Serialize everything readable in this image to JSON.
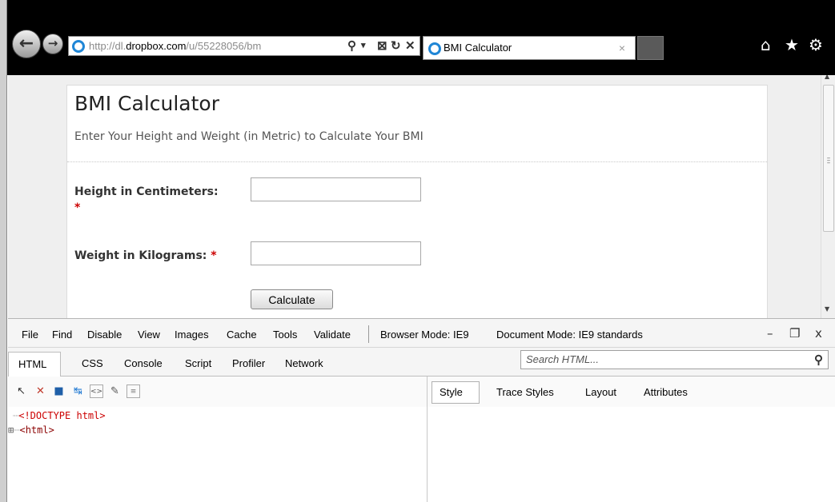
{
  "browser": {
    "address": {
      "prefix": "http://dl.",
      "domain": "dropbox.com",
      "path": "/u/55228056/bm"
    },
    "tab_title": "BMI Calculator",
    "tab_close": "×",
    "icons": [
      "back-icon",
      "forward-icon",
      "search-icon",
      "compat-view-icon",
      "refresh-icon",
      "stop-icon",
      "home-icon",
      "favorites-icon",
      "settings-icon"
    ]
  },
  "page": {
    "title": "BMI Calculator",
    "subtitle": "Enter Your Height and Weight (in Metric) to Calculate Your BMI",
    "height_label": "Height in Centimeters:",
    "weight_label": "Weight in Kilograms:",
    "required_mark": "*",
    "height_value": "",
    "weight_value": "",
    "calculate_label": "Calculate"
  },
  "devtools": {
    "menu": [
      "File",
      "Find",
      "Disable",
      "View",
      "Images",
      "Cache",
      "Tools",
      "Validate"
    ],
    "browser_mode": "Browser Mode: IE9",
    "document_mode": "Document Mode: IE9 standards",
    "tabs": [
      "HTML",
      "CSS",
      "Console",
      "Script",
      "Profiler",
      "Network"
    ],
    "search_placeholder": "Search HTML...",
    "side_tabs": [
      "Style",
      "Trace Styles",
      "Layout",
      "Attributes"
    ],
    "tree": {
      "doctype": "<!DOCTYPE html>",
      "html": "<html>"
    }
  }
}
